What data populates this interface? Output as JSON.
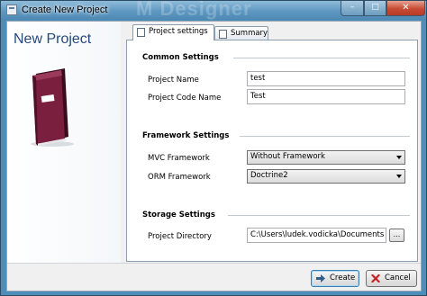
{
  "window": {
    "title": "Create New Project",
    "watermark": "M Designer",
    "min_glyph": "–",
    "max_glyph": "□",
    "close_glyph": "✕"
  },
  "header": {
    "title": "New Project"
  },
  "tabs": [
    {
      "label": "Project settings",
      "icon": "settings-page-icon",
      "selected": true
    },
    {
      "label": "Summary",
      "icon": "summary-page-icon",
      "selected": false
    }
  ],
  "common": {
    "title": "Common Settings",
    "project_name_label": "Project Name",
    "project_name_value": "test",
    "project_code_label": "Project Code Name",
    "project_code_value": "Test"
  },
  "framework": {
    "title": "Framework Settings",
    "mvc_label": "MVC Framework",
    "mvc_value": "Without Framework",
    "orm_label": "ORM Framework",
    "orm_value": "Doctrine2"
  },
  "storage": {
    "title": "Storage Settings",
    "dir_label": "Project Directory",
    "dir_value": "C:\\Users\\ludek.vodicka\\Documents",
    "browse_label": "..."
  },
  "buttons": {
    "create_label": "Create",
    "cancel_label": "Cancel"
  },
  "colors": {
    "heading": "#25497a",
    "titlebar": "#5e98c2",
    "close": "#c74c33",
    "book": "#7a1f3d"
  }
}
